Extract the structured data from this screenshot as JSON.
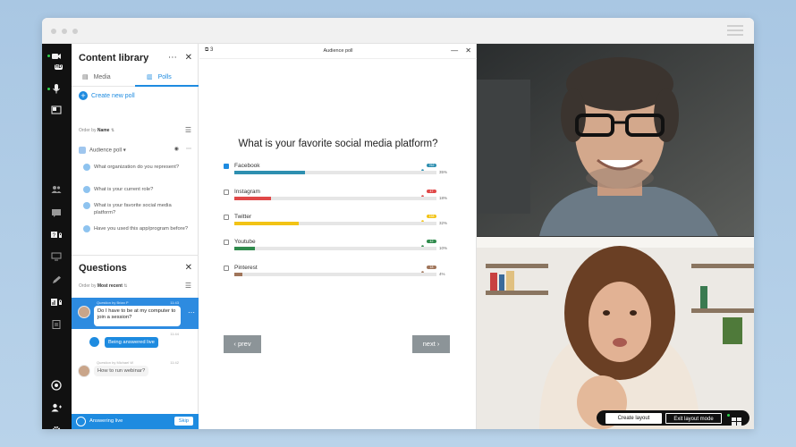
{
  "window": {
    "menu_icon": "hamburger-icon"
  },
  "rail": {
    "icons": [
      "video-icon",
      "microphone-icon",
      "share-screen-icon",
      "people-icon",
      "chat-icon",
      "qa-icon",
      "screen-icon",
      "pen-icon",
      "poll-icon",
      "doc-icon",
      "record-icon",
      "add-user-icon",
      "settings-icon"
    ],
    "hd_label": "HD"
  },
  "content_library": {
    "title": "Content library",
    "tabs": [
      {
        "label": "Media"
      },
      {
        "label": "Polls"
      }
    ],
    "create_label": "Create new poll",
    "order_prefix": "Order by",
    "order_value": "Name",
    "poll_name": "Audience poll",
    "poll_questions": [
      "What organization do you represent?",
      "What is your current role?",
      "What is your favorite social media platform?",
      "Have you used this app/program before?"
    ]
  },
  "questions_panel": {
    "title": "Questions",
    "order_prefix": "Order by",
    "order_value": "Most recent",
    "selected": {
      "meta": "Question by Brian P",
      "time": "11:43",
      "text": "Do I have to be at my computer to join a session?"
    },
    "answer_status": "Being answered live",
    "answer_time": "11:44",
    "second": {
      "meta": "Question by Michael W",
      "time": "11:42",
      "text": "How to run webinar?"
    },
    "footer_label": "Answering live",
    "skip_label": "Skip"
  },
  "poll_view": {
    "counter": "3",
    "title": "Audience poll",
    "question": "What is your favorite social media platform?",
    "options": [
      {
        "name": "Facebook",
        "percent_label": "35%",
        "fill": 0.35,
        "color": "#2e8fb0",
        "checked": true,
        "voter_color": "#2e8fb0",
        "voter_tag": "762"
      },
      {
        "name": "Instagram",
        "percent_label": "18%",
        "fill": 0.18,
        "color": "#e04848",
        "checked": false,
        "voter_color": "#e04848",
        "voter_tag": "47"
      },
      {
        "name": "Twitter",
        "percent_label": "32%",
        "fill": 0.32,
        "color": "#f2c315",
        "checked": false,
        "voter_color": "#f2c315",
        "voter_tag": "158"
      },
      {
        "name": "Youtube",
        "percent_label": "10%",
        "fill": 0.1,
        "color": "#2f8a4c",
        "checked": false,
        "voter_color": "#2f8a4c",
        "voter_tag": "42"
      },
      {
        "name": "Pinterest",
        "percent_label": "4%",
        "fill": 0.04,
        "color": "#a0755a",
        "checked": false,
        "voter_color": "#a0755a",
        "voter_tag": "18"
      }
    ],
    "prev_label": "prev",
    "next_label": "next"
  },
  "video": {
    "create_layout_label": "Create layout",
    "exit_layout_label": "Exit layout mode"
  }
}
